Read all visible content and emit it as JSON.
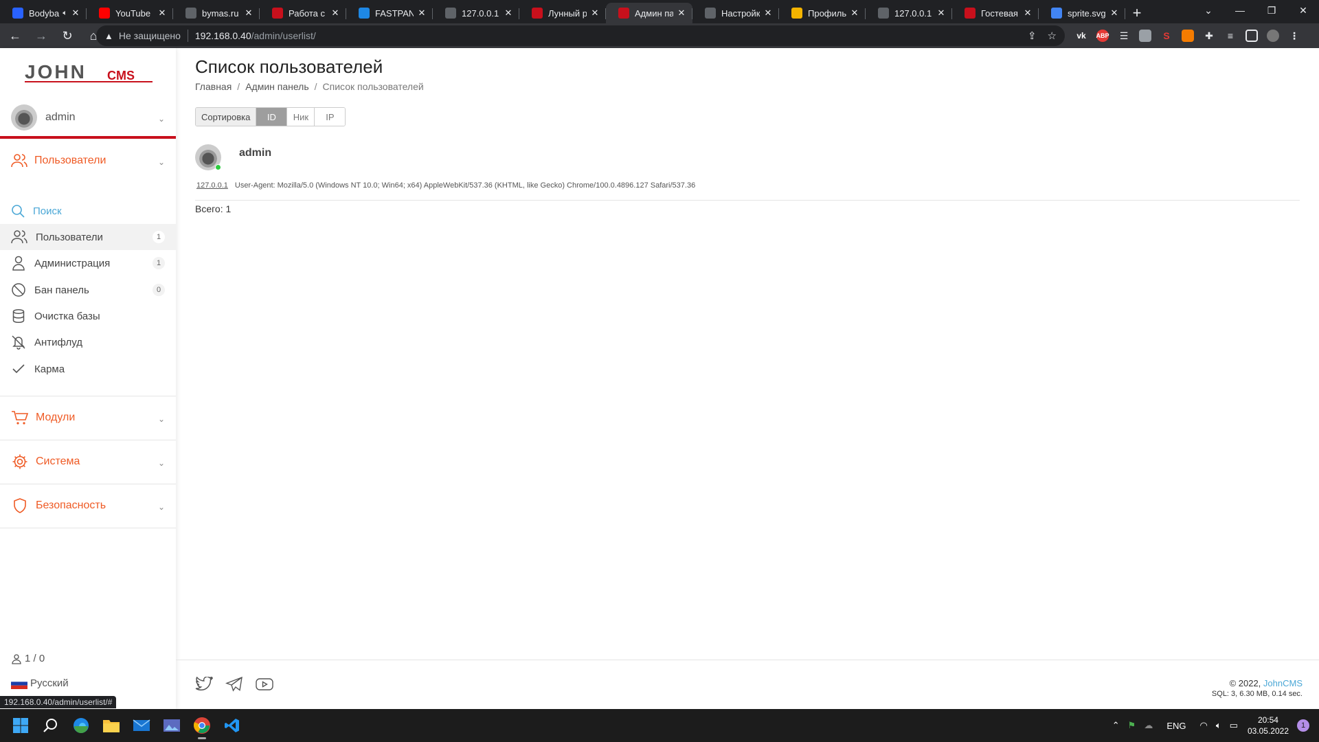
{
  "browser": {
    "tabs": [
      {
        "title": "Bodyba",
        "icon": "video-icon",
        "color": "#2962ff",
        "muted": true
      },
      {
        "title": "YouTube",
        "icon": "youtube-icon",
        "color": "#ff0000"
      },
      {
        "title": "bymas.ru | ",
        "icon": "site-icon",
        "color": "#5f6368"
      },
      {
        "title": "Работа с пс",
        "icon": "johncms-icon",
        "color": "#c8101c"
      },
      {
        "title": "FASTPANEL",
        "icon": "fastpanel-icon",
        "color": "#1e88e5"
      },
      {
        "title": "127.0.0.1",
        "icon": "site-icon",
        "color": "#5f6368"
      },
      {
        "title": "Лунный ры",
        "icon": "johncms-icon",
        "color": "#c8101c"
      },
      {
        "title": "Админ пан",
        "icon": "johncms-icon",
        "color": "#c8101c",
        "active": true
      },
      {
        "title": "Настройки",
        "icon": "settings-icon",
        "color": "#5f6368"
      },
      {
        "title": "Профиль |",
        "icon": "profile-icon",
        "color": "#f4b400"
      },
      {
        "title": "127.0.0.1",
        "icon": "site-icon",
        "color": "#5f6368"
      },
      {
        "title": "Гостевая",
        "icon": "johncms-icon",
        "color": "#c8101c"
      },
      {
        "title": "sprite.svg",
        "icon": "google-icon",
        "color": "#4285f4"
      }
    ],
    "address": {
      "security": "Не защищено",
      "host": "192.168.0.40",
      "path": "/admin/userlist/"
    },
    "status_url": "192.168.0.40/admin/userlist/#"
  },
  "sidebar": {
    "logo": {
      "main": "JOHN",
      "sub": "CMS",
      "color": "#c8101c"
    },
    "user": {
      "name": "admin"
    },
    "sections": {
      "users": "Пользователи",
      "modules": "Модули",
      "system": "Система",
      "security": "Безопасность"
    },
    "items": [
      {
        "label": "Поиск",
        "icon": "search-icon"
      },
      {
        "label": "Пользователи",
        "icon": "users-icon",
        "badge": "1"
      },
      {
        "label": "Администрация",
        "icon": "user-icon",
        "badge": "1"
      },
      {
        "label": "Бан панель",
        "icon": "ban-icon",
        "badge": "0"
      },
      {
        "label": "Очистка базы",
        "icon": "database-icon"
      },
      {
        "label": "Антифлуд",
        "icon": "bell-off-icon"
      },
      {
        "label": "Карма",
        "icon": "check-icon"
      }
    ],
    "online": "1 / 0",
    "language": "Русский"
  },
  "main": {
    "title": "Список пользователей",
    "breadcrumb": [
      "Главная",
      "Админ панель",
      "Список пользователей"
    ],
    "sort": {
      "label": "Сортировка",
      "options": [
        "ID",
        "Ник",
        "IP"
      ],
      "selected": "ID"
    },
    "users": [
      {
        "name": "admin",
        "ip": "127.0.0.1",
        "user_agent": "User-Agent: Mozilla/5.0 (Windows NT 10.0; Win64; x64) AppleWebKit/537.36 (KHTML, like Gecko) Chrome/100.0.4896.127 Safari/537.36",
        "online": true
      }
    ],
    "total": "Всего: 1"
  },
  "footer": {
    "copyright": "© 2022,",
    "brand": "JohnCMS",
    "sql": "SQL: 3, 6.30 MB, 0.14 sec."
  },
  "taskbar": {
    "lang": "ENG",
    "time": "20:54",
    "date": "03.05.2022",
    "notifications": "1"
  },
  "colors": {
    "accent": "#ef5a24",
    "link": "#4aa7d6",
    "brand_red": "#c8101c",
    "online": "#2ecc40"
  }
}
